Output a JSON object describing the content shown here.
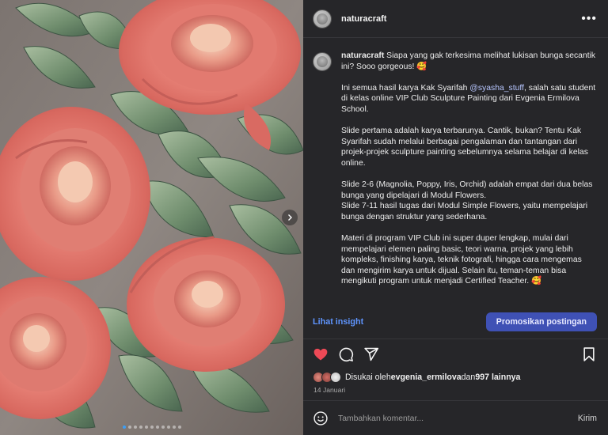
{
  "post": {
    "username": "naturacraft",
    "more_icon": "more-horizontal-icon",
    "slide_count": 11,
    "active_slide": 1
  },
  "caption": {
    "username": "naturacraft",
    "line1": " Siapa yang gak terkesima melihat lukisan bunga secantik ini? Sooo gorgeous! 🥰",
    "p2_pre": "Ini semua hasil karya Kak Syarifah ",
    "p2_mention": "@syasha_stuff",
    "p2_post": ", salah satu student di kelas online VIP Club Sculpture Painting dari Evgenia Ermilova School.",
    "p3": "Slide pertama adalah karya terbarunya. Cantik, bukan? Tentu Kak Syarifah sudah melalui berbagai pengalaman dan tantangan dari projek-projek sculpture painting sebelumnya selama belajar di kelas online.",
    "p4a": "Slide 2-6 (Magnolia, Poppy, Iris, Orchid) adalah empat dari dua belas bunga yang dipelajari di Modul Flowers.",
    "p4b": "Slide 7-11 hasil tugas dari Modul Simple Flowers, yaitu mempelajari bunga dengan struktur yang sederhana.",
    "p5": "Materi di program VIP Club ini super duper lengkap, mulai dari mempelajari elemen paling basic, teori warna, projek yang lebih kompleks, finishing karya, teknik fotografi, hingga cara mengemas dan mengirim karya untuk dijual. Selain itu, teman-teman bisa mengikuti program untuk menjadi Certified Teacher. 🥰"
  },
  "insight": {
    "link_label": "Lihat insight",
    "promote_label": "Promosikan postingan"
  },
  "actions": {
    "like_icon": "heart-filled-icon",
    "comment_icon": "comment-icon",
    "share_icon": "share-icon",
    "save_icon": "bookmark-icon",
    "like_color": "#ed4956"
  },
  "likes": {
    "prefix": "Disukai oleh ",
    "user": "evgenia_ermilova",
    "mid": " dan ",
    "count": "997 lainnya"
  },
  "date": "14 Januari",
  "comment": {
    "placeholder": "Tambahkan komentar...",
    "post_label": "Kirim",
    "emoji_icon": "smiley-icon"
  },
  "colors": {
    "panel_bg": "#262629",
    "accent_link": "#5f95ff",
    "promote_bg": "#3f51b5",
    "mention": "#b7c6ff"
  }
}
